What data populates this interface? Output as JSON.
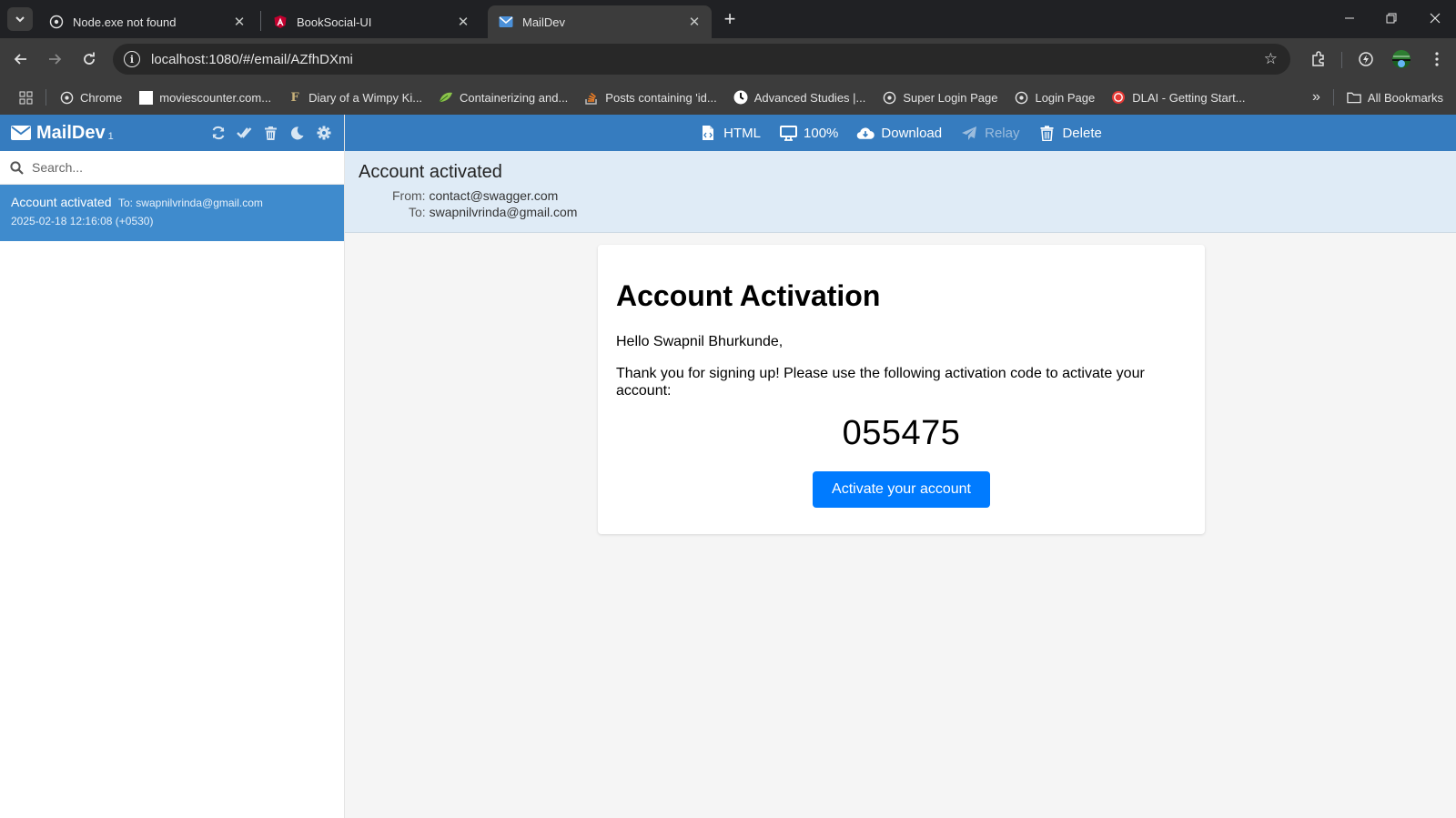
{
  "browser": {
    "tabs": [
      {
        "title": "Node.exe not found",
        "active": false
      },
      {
        "title": "BookSocial-UI",
        "active": false
      },
      {
        "title": "MailDev",
        "active": true
      }
    ],
    "url": "localhost:1080/#/email/AZfhDXmi",
    "bookmarks": [
      "Chrome",
      "moviescounter.com...",
      "Diary of a Wimpy Ki...",
      "Containerizing and...",
      "Posts containing 'id...",
      "Advanced Studies |...",
      "Super Login Page",
      "Login Page",
      "DLAI - Getting Start..."
    ],
    "all_bookmarks": "All Bookmarks"
  },
  "sidebar": {
    "brand": "MailDev",
    "count": "1",
    "search_placeholder": "Search...",
    "mail": {
      "subject": "Account activated",
      "to": "To: swapnilvrinda@gmail.com",
      "date": "2025-02-18 12:16:08 (+0530)"
    }
  },
  "toolbar": {
    "html": "HTML",
    "zoom": "100%",
    "download": "Download",
    "relay": "Relay",
    "delete": "Delete"
  },
  "message": {
    "subject": "Account activated",
    "from_label": "From:",
    "from": "contact@swagger.com",
    "to_label": "To:",
    "to": "swapnilvrinda@gmail.com"
  },
  "email_body": {
    "heading": "Account Activation",
    "greeting": "Hello Swapnil Bhurkunde,",
    "text": "Thank you for signing up! Please use the following activation code to activate your account:",
    "code": "055475",
    "button": "Activate your account"
  },
  "colors": {
    "brand_blue": "#367cbf",
    "selected_item": "#3f8bcd",
    "activate_button": "#007bff"
  }
}
